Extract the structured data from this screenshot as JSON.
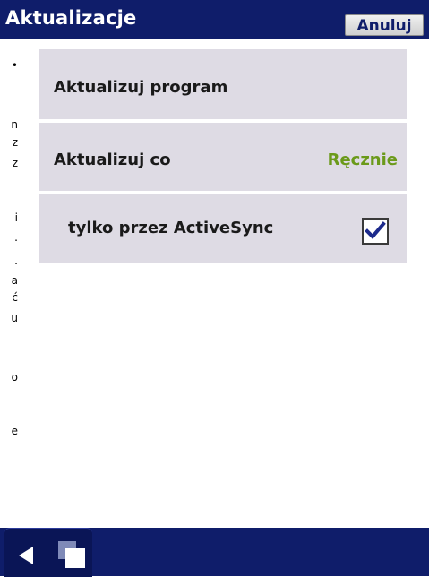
{
  "header": {
    "title": "Aktualizacje",
    "cancel_label": "Anuluj"
  },
  "background_text_fragments": [
    "•",
    "n",
    "z",
    "z",
    "i",
    ".",
    ".",
    "a",
    "ć",
    "u",
    "o",
    "e"
  ],
  "settings": {
    "items": [
      {
        "label": "Aktualizuj program"
      },
      {
        "label": "Aktualizuj co",
        "value": "Ręcznie"
      },
      {
        "label": "tylko przez ActiveSync",
        "checked": true
      }
    ]
  },
  "bottom_bar": {
    "icons": [
      "back-icon",
      "windows-icon"
    ]
  },
  "colors": {
    "title_bar": "#0f1d6a",
    "row_background": "#dedbe4",
    "value_text": "#6b9a1a"
  }
}
